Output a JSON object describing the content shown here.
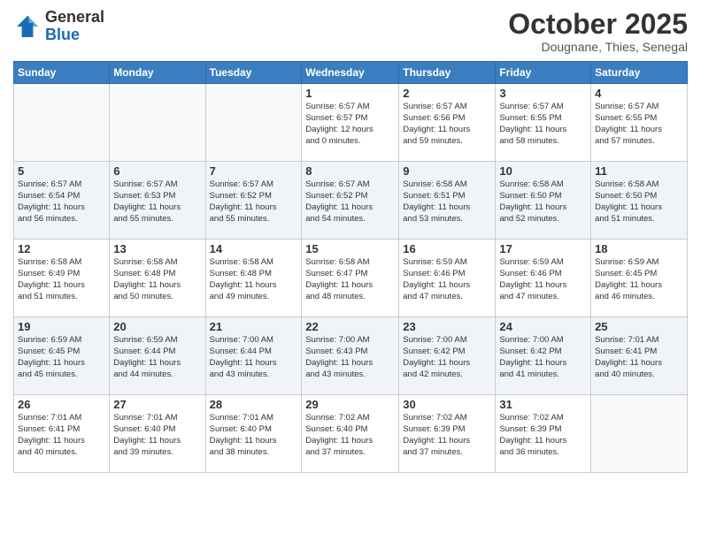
{
  "logo": {
    "general": "General",
    "blue": "Blue"
  },
  "header": {
    "month": "October 2025",
    "location": "Dougnane, Thies, Senegal"
  },
  "weekdays": [
    "Sunday",
    "Monday",
    "Tuesday",
    "Wednesday",
    "Thursday",
    "Friday",
    "Saturday"
  ],
  "weeks": [
    [
      {
        "day": "",
        "info": ""
      },
      {
        "day": "",
        "info": ""
      },
      {
        "day": "",
        "info": ""
      },
      {
        "day": "1",
        "info": "Sunrise: 6:57 AM\nSunset: 6:57 PM\nDaylight: 12 hours\nand 0 minutes."
      },
      {
        "day": "2",
        "info": "Sunrise: 6:57 AM\nSunset: 6:56 PM\nDaylight: 11 hours\nand 59 minutes."
      },
      {
        "day": "3",
        "info": "Sunrise: 6:57 AM\nSunset: 6:55 PM\nDaylight: 11 hours\nand 58 minutes."
      },
      {
        "day": "4",
        "info": "Sunrise: 6:57 AM\nSunset: 6:55 PM\nDaylight: 11 hours\nand 57 minutes."
      }
    ],
    [
      {
        "day": "5",
        "info": "Sunrise: 6:57 AM\nSunset: 6:54 PM\nDaylight: 11 hours\nand 56 minutes."
      },
      {
        "day": "6",
        "info": "Sunrise: 6:57 AM\nSunset: 6:53 PM\nDaylight: 11 hours\nand 55 minutes."
      },
      {
        "day": "7",
        "info": "Sunrise: 6:57 AM\nSunset: 6:52 PM\nDaylight: 11 hours\nand 55 minutes."
      },
      {
        "day": "8",
        "info": "Sunrise: 6:57 AM\nSunset: 6:52 PM\nDaylight: 11 hours\nand 54 minutes."
      },
      {
        "day": "9",
        "info": "Sunrise: 6:58 AM\nSunset: 6:51 PM\nDaylight: 11 hours\nand 53 minutes."
      },
      {
        "day": "10",
        "info": "Sunrise: 6:58 AM\nSunset: 6:50 PM\nDaylight: 11 hours\nand 52 minutes."
      },
      {
        "day": "11",
        "info": "Sunrise: 6:58 AM\nSunset: 6:50 PM\nDaylight: 11 hours\nand 51 minutes."
      }
    ],
    [
      {
        "day": "12",
        "info": "Sunrise: 6:58 AM\nSunset: 6:49 PM\nDaylight: 11 hours\nand 51 minutes."
      },
      {
        "day": "13",
        "info": "Sunrise: 6:58 AM\nSunset: 6:48 PM\nDaylight: 11 hours\nand 50 minutes."
      },
      {
        "day": "14",
        "info": "Sunrise: 6:58 AM\nSunset: 6:48 PM\nDaylight: 11 hours\nand 49 minutes."
      },
      {
        "day": "15",
        "info": "Sunrise: 6:58 AM\nSunset: 6:47 PM\nDaylight: 11 hours\nand 48 minutes."
      },
      {
        "day": "16",
        "info": "Sunrise: 6:59 AM\nSunset: 6:46 PM\nDaylight: 11 hours\nand 47 minutes."
      },
      {
        "day": "17",
        "info": "Sunrise: 6:59 AM\nSunset: 6:46 PM\nDaylight: 11 hours\nand 47 minutes."
      },
      {
        "day": "18",
        "info": "Sunrise: 6:59 AM\nSunset: 6:45 PM\nDaylight: 11 hours\nand 46 minutes."
      }
    ],
    [
      {
        "day": "19",
        "info": "Sunrise: 6:59 AM\nSunset: 6:45 PM\nDaylight: 11 hours\nand 45 minutes."
      },
      {
        "day": "20",
        "info": "Sunrise: 6:59 AM\nSunset: 6:44 PM\nDaylight: 11 hours\nand 44 minutes."
      },
      {
        "day": "21",
        "info": "Sunrise: 7:00 AM\nSunset: 6:44 PM\nDaylight: 11 hours\nand 43 minutes."
      },
      {
        "day": "22",
        "info": "Sunrise: 7:00 AM\nSunset: 6:43 PM\nDaylight: 11 hours\nand 43 minutes."
      },
      {
        "day": "23",
        "info": "Sunrise: 7:00 AM\nSunset: 6:42 PM\nDaylight: 11 hours\nand 42 minutes."
      },
      {
        "day": "24",
        "info": "Sunrise: 7:00 AM\nSunset: 6:42 PM\nDaylight: 11 hours\nand 41 minutes."
      },
      {
        "day": "25",
        "info": "Sunrise: 7:01 AM\nSunset: 6:41 PM\nDaylight: 11 hours\nand 40 minutes."
      }
    ],
    [
      {
        "day": "26",
        "info": "Sunrise: 7:01 AM\nSunset: 6:41 PM\nDaylight: 11 hours\nand 40 minutes."
      },
      {
        "day": "27",
        "info": "Sunrise: 7:01 AM\nSunset: 6:40 PM\nDaylight: 11 hours\nand 39 minutes."
      },
      {
        "day": "28",
        "info": "Sunrise: 7:01 AM\nSunset: 6:40 PM\nDaylight: 11 hours\nand 38 minutes."
      },
      {
        "day": "29",
        "info": "Sunrise: 7:02 AM\nSunset: 6:40 PM\nDaylight: 11 hours\nand 37 minutes."
      },
      {
        "day": "30",
        "info": "Sunrise: 7:02 AM\nSunset: 6:39 PM\nDaylight: 11 hours\nand 37 minutes."
      },
      {
        "day": "31",
        "info": "Sunrise: 7:02 AM\nSunset: 6:39 PM\nDaylight: 11 hours\nand 36 minutes."
      },
      {
        "day": "",
        "info": ""
      }
    ]
  ]
}
